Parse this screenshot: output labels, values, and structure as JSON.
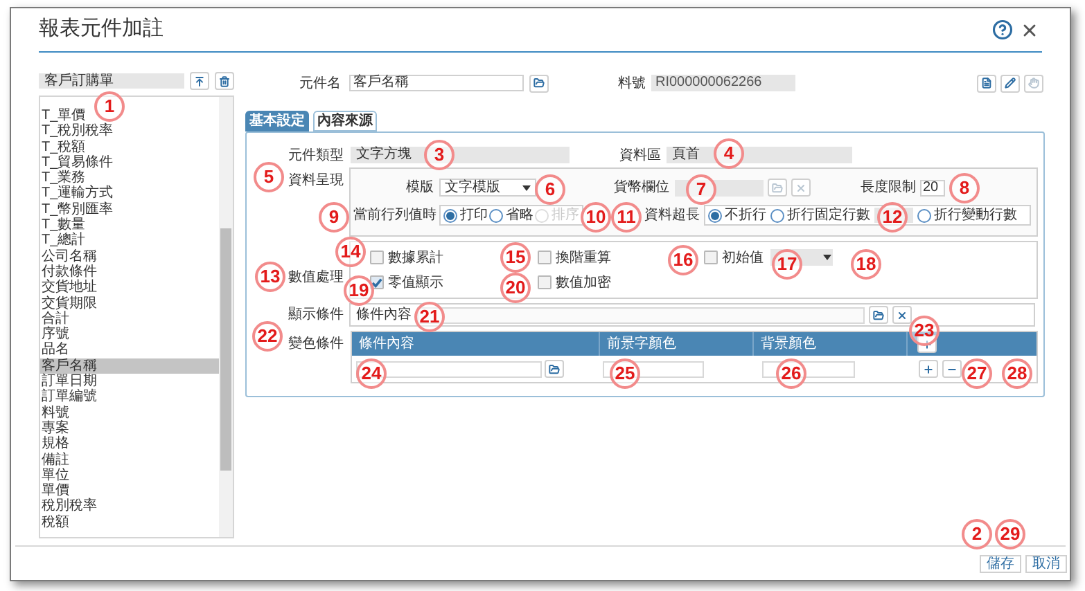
{
  "window": {
    "title": "報表元件加註"
  },
  "left_panel": {
    "report": "客戶訂購單",
    "items": [
      {
        "label": "T_單價",
        "selected": false
      },
      {
        "label": "T_稅別稅率",
        "selected": false
      },
      {
        "label": "T_稅額",
        "selected": false
      },
      {
        "label": "T_貿易條件",
        "selected": false
      },
      {
        "label": "T_業務",
        "selected": false
      },
      {
        "label": "T_運輸方式",
        "selected": false
      },
      {
        "label": "T_幣別匯率",
        "selected": false
      },
      {
        "label": "T_數量",
        "selected": false
      },
      {
        "label": "T_總計",
        "selected": false
      },
      {
        "label": "公司名稱",
        "selected": false
      },
      {
        "label": "付款條件",
        "selected": false
      },
      {
        "label": "交貨地址",
        "selected": false
      },
      {
        "label": "交貨期限",
        "selected": false
      },
      {
        "label": "合計",
        "selected": false
      },
      {
        "label": "序號",
        "selected": false
      },
      {
        "label": "品名",
        "selected": false
      },
      {
        "label": "客戶名稱",
        "selected": true
      },
      {
        "label": "訂單日期",
        "selected": false
      },
      {
        "label": "訂單編號",
        "selected": false
      },
      {
        "label": "料號",
        "selected": false
      },
      {
        "label": "專案",
        "selected": false
      },
      {
        "label": "規格",
        "selected": false
      },
      {
        "label": "備註",
        "selected": false
      },
      {
        "label": "單位",
        "selected": false
      },
      {
        "label": "單價",
        "selected": false
      },
      {
        "label": "稅別稅率",
        "selected": false
      },
      {
        "label": "稅額",
        "selected": false
      }
    ]
  },
  "header": {
    "name_label": "元件名",
    "name_value": "客戶名稱",
    "part_label": "料號",
    "part_value": "RI000000062266"
  },
  "tabs": [
    {
      "label": "基本設定",
      "selected": true
    },
    {
      "label": "內容來源",
      "selected": false
    }
  ],
  "basic": {
    "type_label": "元件類型",
    "type_value": "文字方塊",
    "area_label": "資料區",
    "area_value": "頁首",
    "presentation_label": "資料呈現",
    "template_label": "模版",
    "template_value": "文字模版",
    "currency_label": "貨幣欄位",
    "length_label": "長度限制",
    "length_value": "20",
    "current_label": "當前行列值時",
    "current_options": [
      {
        "label": "打印",
        "selected": true,
        "disabled": false
      },
      {
        "label": "省略",
        "selected": false,
        "disabled": false
      },
      {
        "label": "排序",
        "selected": false,
        "disabled": true
      }
    ],
    "overflow_label": "資料超長",
    "overflow_options": [
      {
        "kind": "radio",
        "label": "不折行",
        "selected": true
      },
      {
        "kind": "radio",
        "label": "折行固定行數",
        "selected": false
      },
      {
        "kind": "count_field"
      },
      {
        "kind": "radio",
        "label": "折行變動行數",
        "selected": false
      }
    ],
    "numeric_label": "數值處理",
    "checks": [
      {
        "label": "數據累計",
        "checked": false
      },
      {
        "label": "換階重算",
        "checked": false
      },
      {
        "label": "零值顯示",
        "checked": true
      },
      {
        "label": "數值加密",
        "checked": false
      }
    ],
    "initial": {
      "label": "初始值",
      "checked": false
    },
    "display_label": "顯示條件",
    "condition_label": "條件內容",
    "color_label": "變色條件",
    "color_columns": [
      "條件內容",
      "前景字顏色",
      "背景顏色"
    ]
  },
  "markers": [
    "1",
    "2",
    "3",
    "4",
    "5",
    "6",
    "7",
    "8",
    "9",
    "10",
    "11",
    "12",
    "13",
    "14",
    "15",
    "16",
    "17",
    "18",
    "19",
    "20",
    "21",
    "22",
    "23",
    "24",
    "25",
    "26",
    "27",
    "28",
    "29"
  ],
  "buttons": [
    {
      "label": "儲存"
    },
    {
      "label": "取消"
    }
  ]
}
